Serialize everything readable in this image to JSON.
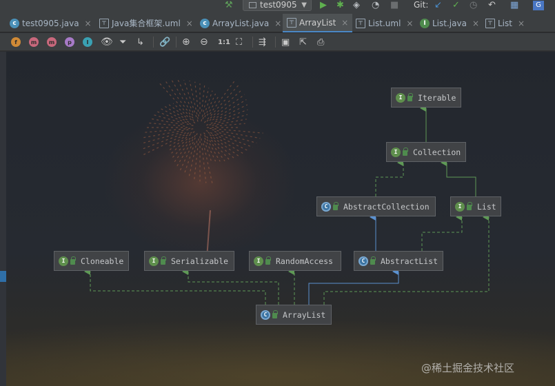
{
  "topbar": {
    "run_config": "test0905",
    "git_label": "Git:"
  },
  "tabs": [
    {
      "label": "test0905.java",
      "icon": "c",
      "active": false
    },
    {
      "label": "Java集合框架.uml",
      "icon": "u",
      "active": false
    },
    {
      "label": "ArrayList.java",
      "icon": "c",
      "active": false
    },
    {
      "label": "ArrayList",
      "icon": "u",
      "active": true
    },
    {
      "label": "List.uml",
      "icon": "u",
      "active": false
    },
    {
      "label": "List.java",
      "icon": "i",
      "active": false
    },
    {
      "label": "List",
      "icon": "u",
      "active": false
    }
  ],
  "toolbar": {
    "filters": [
      {
        "letter": "f",
        "color": "#d08a36"
      },
      {
        "letter": "m",
        "color": "#c8687c"
      },
      {
        "letter": "m",
        "color": "#c8687c"
      },
      {
        "letter": "p",
        "color": "#a77ac7"
      },
      {
        "letter": "I",
        "color": "#3aa1b3"
      }
    ],
    "actual_size": "1:1"
  },
  "diagram": {
    "nodes": [
      {
        "id": "iterable",
        "label": "Iterable",
        "kind": "I"
      },
      {
        "id": "collection",
        "label": "Collection",
        "kind": "I"
      },
      {
        "id": "abstract_collection",
        "label": "AbstractCollection",
        "kind": "C"
      },
      {
        "id": "list",
        "label": "List",
        "kind": "I"
      },
      {
        "id": "cloneable",
        "label": "Cloneable",
        "kind": "I"
      },
      {
        "id": "serializable",
        "label": "Serializable",
        "kind": "I"
      },
      {
        "id": "random_access",
        "label": "RandomAccess",
        "kind": "I"
      },
      {
        "id": "abstract_list",
        "label": "AbstractList",
        "kind": "C"
      },
      {
        "id": "array_list",
        "label": "ArrayList",
        "kind": "C"
      }
    ],
    "colors": {
      "extends_edge": "#5b91d0",
      "implements_edge": "#5f9956",
      "interface_badge": "#5f8f4d",
      "class_badge": "#3b74a3"
    }
  },
  "watermark": "@稀土掘金技术社区"
}
